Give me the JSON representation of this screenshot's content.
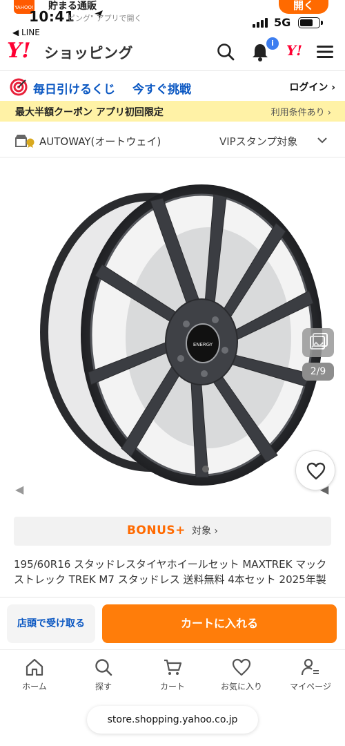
{
  "status_bar": {
    "app_name": "貯まる通販",
    "app_logo_text": "YAHOO!",
    "time": "10:41",
    "app_hint": "ピング\" アプリで開く",
    "open_label": "開く",
    "network": "5G",
    "back_label": "◀ LINE"
  },
  "header": {
    "logo_mark": "Y!",
    "logo_text": "ショッピング",
    "bell_badge": "i",
    "y_mini": "Y!"
  },
  "lottery": {
    "label": "毎日引けるくじ",
    "cta": "今すぐ挑戦",
    "login": "ログイン ›"
  },
  "coupon": {
    "text": "最大半額クーポン アプリ初回限定",
    "terms": "利用条件あり ›"
  },
  "store": {
    "name": "AUTOWAY(オートウェイ)",
    "vip": "VIPスタンプ対象"
  },
  "gallery": {
    "counter": "2/9",
    "hub_label": "ENERGY"
  },
  "bonus": {
    "brand": "BONUS+",
    "suffix": "対象 ›"
  },
  "product": {
    "title": "195/60R16 スタッドレスタイヤホイールセット MAXTREK マックストレック TREK M7 スタッドレス 送料無料 4本セット 2025年製"
  },
  "actions": {
    "pickup": "店頭で受け取る",
    "add_to_cart": "カートに入れる"
  },
  "nav": {
    "home": "ホーム",
    "search": "探す",
    "cart": "カート",
    "favorites": "お気に入り",
    "mypage": "マイページ"
  },
  "url": "store.shopping.yahoo.co.jp",
  "colors": {
    "brand_red": "#ff0033",
    "accent_orange": "#ff7d0a",
    "link_blue": "#0a57c2",
    "coupon_yellow": "#fff2a6"
  }
}
